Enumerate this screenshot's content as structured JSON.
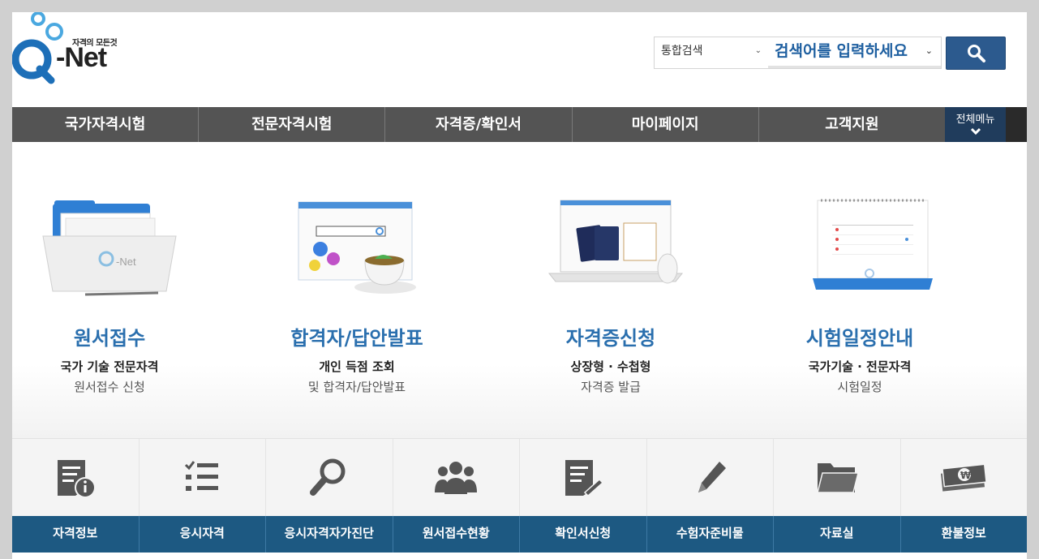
{
  "header": {
    "logo_tagline": "자격의 모든것",
    "logo_name": "-Net",
    "search": {
      "category": "통합검색",
      "placeholder": "검색어를 입력하세요"
    }
  },
  "gnb": {
    "items": [
      "국가자격시험",
      "전문자격시험",
      "자격증/확인서",
      "마이페이지",
      "고객지원"
    ],
    "all_menu_label": "전체메뉴"
  },
  "features": [
    {
      "title": "원서접수",
      "line1": "국가 기술 전문자격",
      "line2": "원서접수 신청"
    },
    {
      "title": "합격자/답안발표",
      "line1": "개인 득점 조회",
      "line2": "및 합격자/답안발표"
    },
    {
      "title": "자격증신청",
      "line1": "상장형 · 수첩형",
      "line2": "자격증 발급"
    },
    {
      "title": "시험일정안내",
      "line1": "국가기술 · 전문자격",
      "line2": "시험일정"
    }
  ],
  "quick_menu": [
    {
      "label": "자격정보",
      "icon": "document-info-icon"
    },
    {
      "label": "응시자격",
      "icon": "checklist-icon"
    },
    {
      "label": "응시자격자가진단",
      "icon": "magnifier-icon"
    },
    {
      "label": "원서접수현황",
      "icon": "group-users-icon"
    },
    {
      "label": "확인서신청",
      "icon": "document-edit-icon"
    },
    {
      "label": "수험자준비물",
      "icon": "pencil-icon"
    },
    {
      "label": "자료실",
      "icon": "folder-icon"
    },
    {
      "label": "환불정보",
      "icon": "money-bills-icon"
    }
  ],
  "colors": {
    "brand_blue": "#2a6fae",
    "gnb_gray": "#545454",
    "quick_bar": "#1d5982",
    "search_button": "#2c5a8e"
  }
}
